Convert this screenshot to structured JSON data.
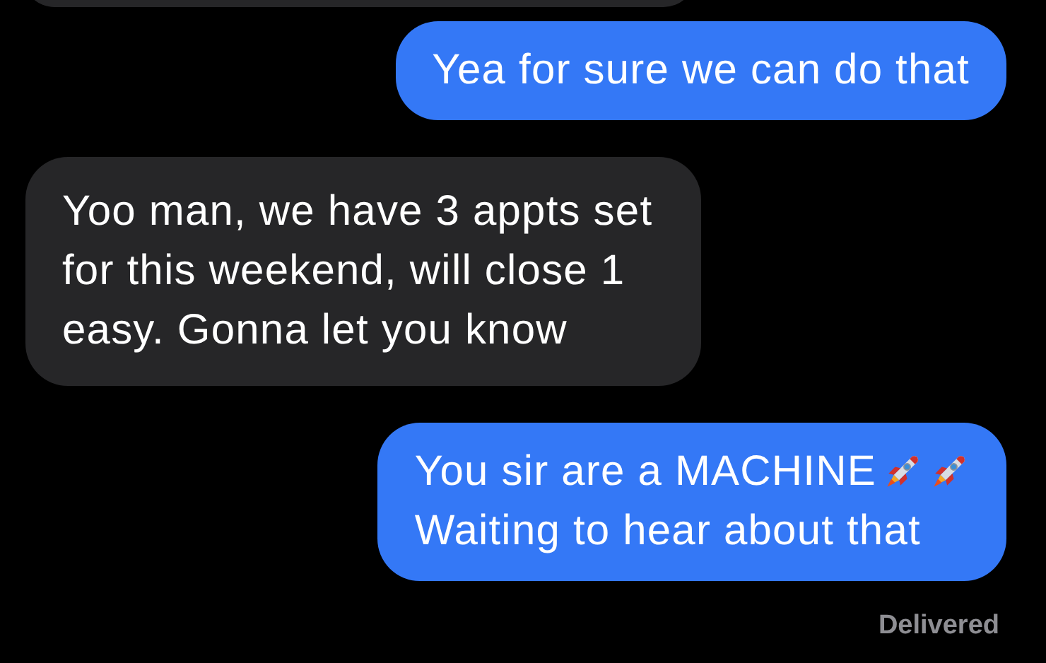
{
  "messages": [
    {
      "kind": "outgoing",
      "lines": [
        {
          "text": "Yea for sure we can do that"
        }
      ]
    },
    {
      "kind": "incoming",
      "lines": [
        {
          "text": "Yoo man, we have 3 appts set"
        },
        {
          "text": "for this weekend, will close 1"
        },
        {
          "text": "easy. Gonna let you know"
        }
      ]
    },
    {
      "kind": "outgoing",
      "lines": [
        {
          "text": "You sir are a MACHINE",
          "icons": [
            {
              "kind": "rocket"
            },
            {
              "kind": "rocket"
            }
          ]
        },
        {
          "text": "Waiting to hear about that"
        }
      ]
    }
  ],
  "status": "Delivered"
}
